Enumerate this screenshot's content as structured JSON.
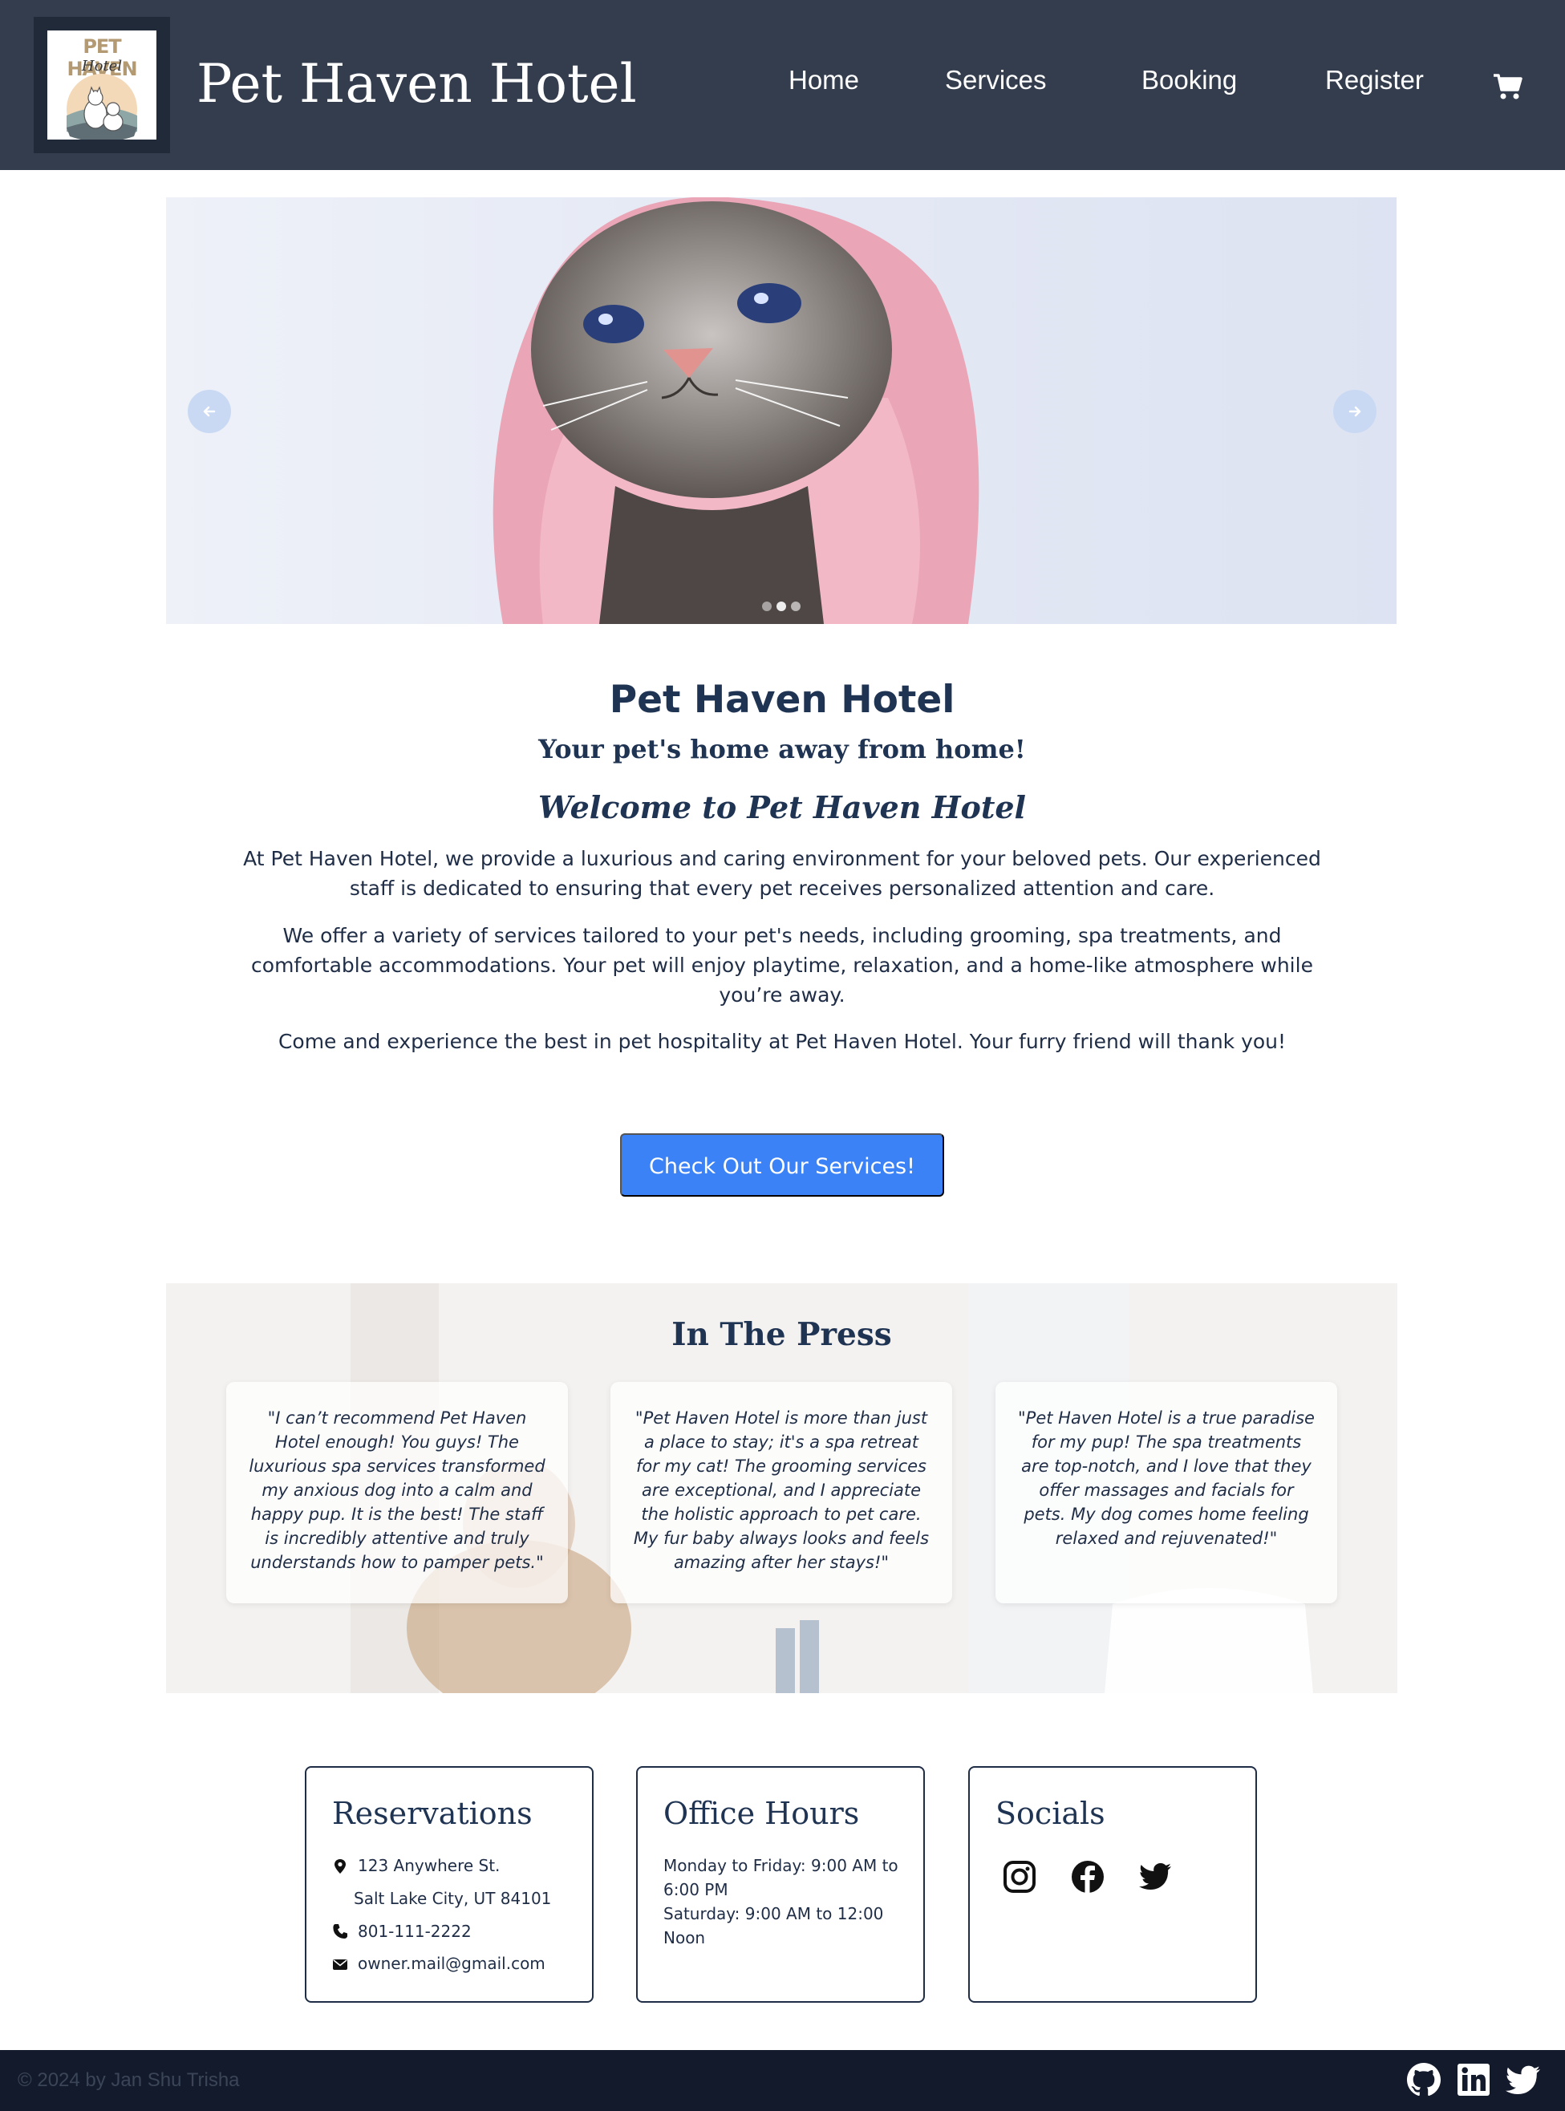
{
  "header": {
    "logo": {
      "word": "PET HAVEN",
      "sub": "Hotel"
    },
    "title": "Pet Haven Hotel",
    "nav": [
      {
        "label": "Home"
      },
      {
        "label": "Services"
      },
      {
        "label": "Booking"
      },
      {
        "label": "Register"
      }
    ],
    "cart_icon": "shopping-cart-icon"
  },
  "hero": {
    "image": "wet-cat-in-pink-towel",
    "prev_icon": "arrow-left-icon",
    "next_icon": "arrow-right-icon",
    "slides": 3,
    "active_slide": 2
  },
  "intro": {
    "heading": "Pet Haven Hotel",
    "tagline": "Your pet's home away from home!",
    "welcome": "Welcome to Pet Haven Hotel",
    "paragraphs": [
      "At Pet Haven Hotel, we provide a luxurious and caring environment for your beloved pets. Our experienced staff is dedicated to ensuring that every pet receives personalized attention and care.",
      "We offer a variety of services tailored to your pet's needs, including grooming, spa treatments, and comfortable accommodations. Your pet will enjoy playtime, relaxation, and a home-like atmosphere while you’re away.",
      "Come and experience the best in pet hospitality at Pet Haven Hotel. Your furry friend will thank you!"
    ],
    "cta_label": "Check Out Our Services!"
  },
  "press": {
    "heading": "In The Press",
    "quotes": [
      "\"I can’t recommend Pet Haven Hotel enough! You guys! The luxurious spa services transformed my anxious dog into a calm and happy pup. It is the best! The staff is incredibly attentive and truly understands how to pamper pets.\"",
      "\"Pet Haven Hotel is more than just a place to stay; it's a spa retreat for my cat! The grooming services are exceptional, and I appreciate the holistic approach to pet care. My fur baby always looks and feels amazing after her stays!\"",
      "\"Pet Haven Hotel is a true paradise for my pup! The spa treatments are top-notch, and I love that they offer massages and facials for pets. My dog comes home feeling relaxed and rejuvenated!\""
    ]
  },
  "reservations": {
    "title": "Reservations",
    "address_line1": "123 Anywhere St.",
    "address_line2": "Salt Lake City, UT 84101",
    "phone": "801-111-2222",
    "email": "owner.mail@gmail.com"
  },
  "office_hours": {
    "title": "Office Hours",
    "lines": [
      "Monday to Friday: 9:00 AM to",
      "6:00 PM",
      "Saturday: 9:00 AM to 12:00",
      "Noon"
    ]
  },
  "socials": {
    "title": "Socials",
    "icons": [
      "instagram-icon",
      "facebook-icon",
      "twitter-icon"
    ]
  },
  "footer": {
    "copyright": "© 2024 by Jan Shu Trisha",
    "icons": [
      "github-icon",
      "linkedin-icon",
      "twitter-icon"
    ]
  },
  "colors": {
    "header_bg": "#333d4d",
    "footer_bg": "#131a2c",
    "accent": "#3b82f6",
    "heading": "#1f3352",
    "text": "#1f2d46"
  }
}
